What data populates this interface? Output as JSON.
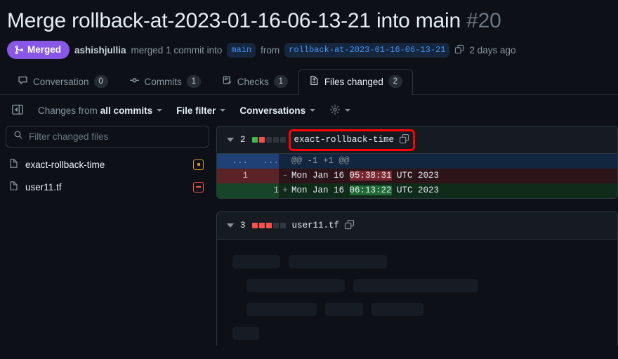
{
  "header": {
    "title": "Merge rollback-at-2023-01-16-06-13-21 into main",
    "number": "#20",
    "status_badge": "Merged",
    "status_icon": "git-merge-icon",
    "actor": "ashishjullia",
    "merged_text": "merged 1 commit into",
    "base_branch": "main",
    "from_text": "from",
    "head_branch": "rollback-at-2023-01-16-06-13-21",
    "copy_icon": "copy-icon",
    "timestamp": "2 days ago"
  },
  "tabs": [
    {
      "label": "Conversation",
      "count": "0",
      "icon": "comment-icon",
      "active": false
    },
    {
      "label": "Commits",
      "count": "1",
      "icon": "commit-icon",
      "active": false
    },
    {
      "label": "Checks",
      "count": "1",
      "icon": "checklist-icon",
      "active": false
    },
    {
      "label": "Files changed",
      "count": "2",
      "icon": "file-diff-icon",
      "active": true
    }
  ],
  "toolbar": {
    "sidebar_toggle_icon": "sidebar-expand-icon",
    "changes_from_label": "Changes from",
    "changes_from_value": "all commits",
    "file_filter_label": "File filter",
    "conversations_label": "Conversations",
    "settings_icon": "gear-icon"
  },
  "sidebar": {
    "search_placeholder": "Filter changed files",
    "search_value": "",
    "search_icon": "search-icon",
    "files": [
      {
        "name": "exact-rollback-time",
        "icon": "file-icon",
        "status": "modified",
        "status_icon": "dot-square-icon"
      },
      {
        "name": "user11.tf",
        "icon": "file-icon",
        "status": "removed",
        "status_icon": "dash-square-icon"
      }
    ]
  },
  "diffs": [
    {
      "change_count": "2",
      "bars": [
        "add",
        "del",
        "none",
        "none",
        "none"
      ],
      "filename": "exact-rollback-time",
      "copy_icon": "copy-icon",
      "collapse_icon": "chevron-down-icon",
      "highlighted": true,
      "rows": [
        {
          "type": "hunk",
          "old_ln": "...",
          "new_ln": "...",
          "sign": "",
          "code_pre": "@@ -1 +1 @@",
          "code_hl": "",
          "code_post": ""
        },
        {
          "type": "del",
          "old_ln": "1",
          "new_ln": "",
          "sign": "-",
          "code_pre": "Mon Jan 16 ",
          "code_hl": "05:38:31",
          "code_post": " UTC 2023"
        },
        {
          "type": "add",
          "old_ln": "",
          "new_ln": "1",
          "sign": "+",
          "code_pre": "Mon Jan 16 ",
          "code_hl": "06:13:22",
          "code_post": " UTC 2023"
        }
      ]
    },
    {
      "change_count": "3",
      "bars": [
        "del",
        "del",
        "del",
        "none",
        "none"
      ],
      "filename": "user11.tf",
      "copy_icon": "copy-icon",
      "collapse_icon": "chevron-down-icon",
      "highlighted": false,
      "rows": [],
      "loading_skeleton": true
    }
  ],
  "colors": {
    "background": "#0d1117",
    "merged_purple": "#8957e5",
    "addition_green": "#3fb950",
    "deletion_red": "#f85149",
    "modified_yellow": "#d29922",
    "annotation_red": "#ff0000",
    "link_blue": "#4493f8"
  }
}
